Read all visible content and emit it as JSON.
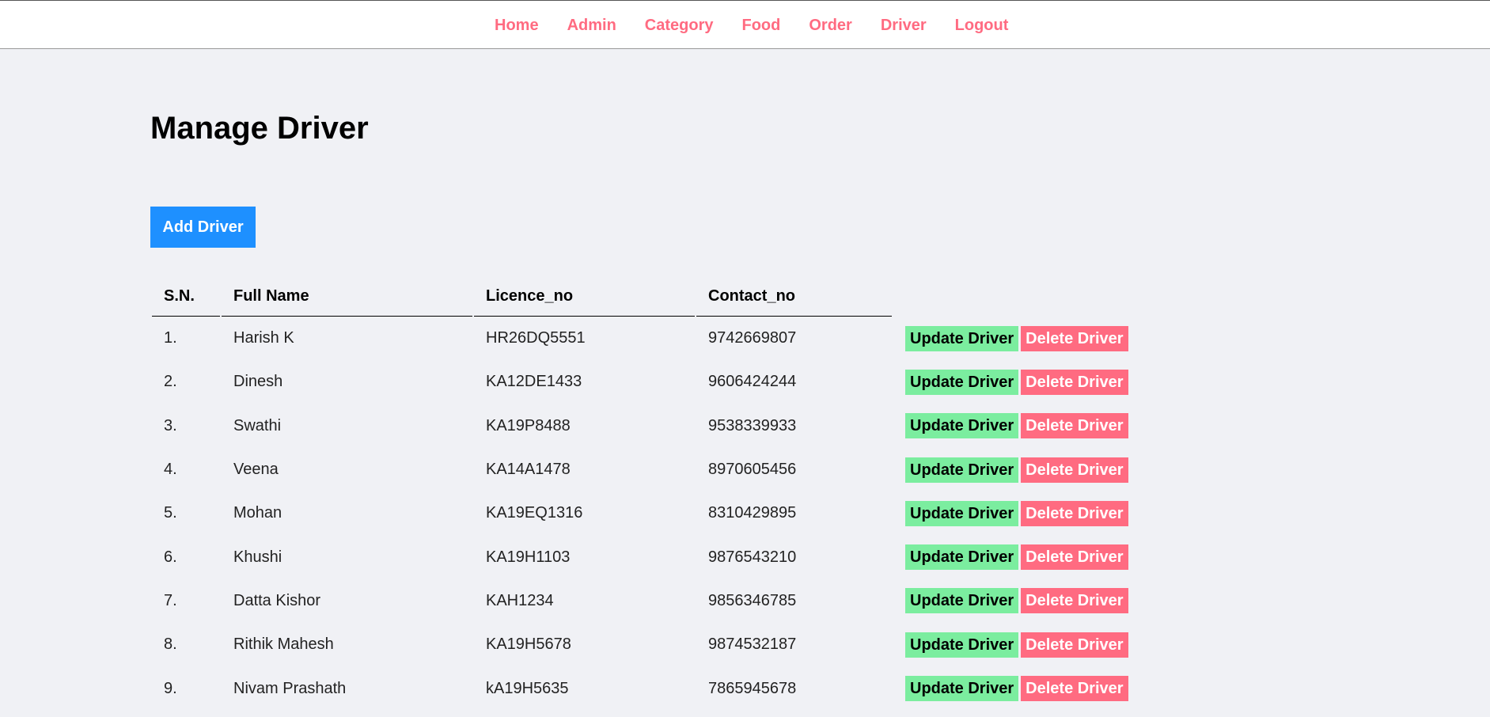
{
  "nav": {
    "items": [
      "Home",
      "Admin",
      "Category",
      "Food",
      "Order",
      "Driver",
      "Logout"
    ]
  },
  "page": {
    "title": "Manage Driver",
    "add_button": "Add Driver"
  },
  "table": {
    "headers": [
      "S.N.",
      "Full Name",
      "Licence_no",
      "Contact_no"
    ],
    "update_label": "Update Driver",
    "delete_label": "Delete Driver",
    "rows": [
      {
        "sn": "1.",
        "name": "Harish K",
        "licence": "HR26DQ5551",
        "contact": "9742669807"
      },
      {
        "sn": "2.",
        "name": "Dinesh",
        "licence": "KA12DE1433",
        "contact": "9606424244"
      },
      {
        "sn": "3.",
        "name": "Swathi",
        "licence": "KA19P8488",
        "contact": "9538339933"
      },
      {
        "sn": "4.",
        "name": "Veena",
        "licence": "KA14A1478",
        "contact": "8970605456"
      },
      {
        "sn": "5.",
        "name": "Mohan",
        "licence": "KA19EQ1316",
        "contact": "8310429895"
      },
      {
        "sn": "6.",
        "name": "Khushi",
        "licence": "KA19H1103",
        "contact": "9876543210"
      },
      {
        "sn": "7.",
        "name": "Datta Kishor",
        "licence": "KAH1234",
        "contact": "9856346785"
      },
      {
        "sn": "8.",
        "name": "Rithik Mahesh",
        "licence": "KA19H5678",
        "contact": "9874532187"
      },
      {
        "sn": "9.",
        "name": "Nivam Prashath",
        "licence": "kA19H5635",
        "contact": "7865945678"
      }
    ]
  },
  "colors": {
    "nav_link": "#ff6b81",
    "add_button": "#1e90ff",
    "update_button": "#7bed9f",
    "delete_button": "#ff6b81",
    "background": "#f0f1f5"
  }
}
